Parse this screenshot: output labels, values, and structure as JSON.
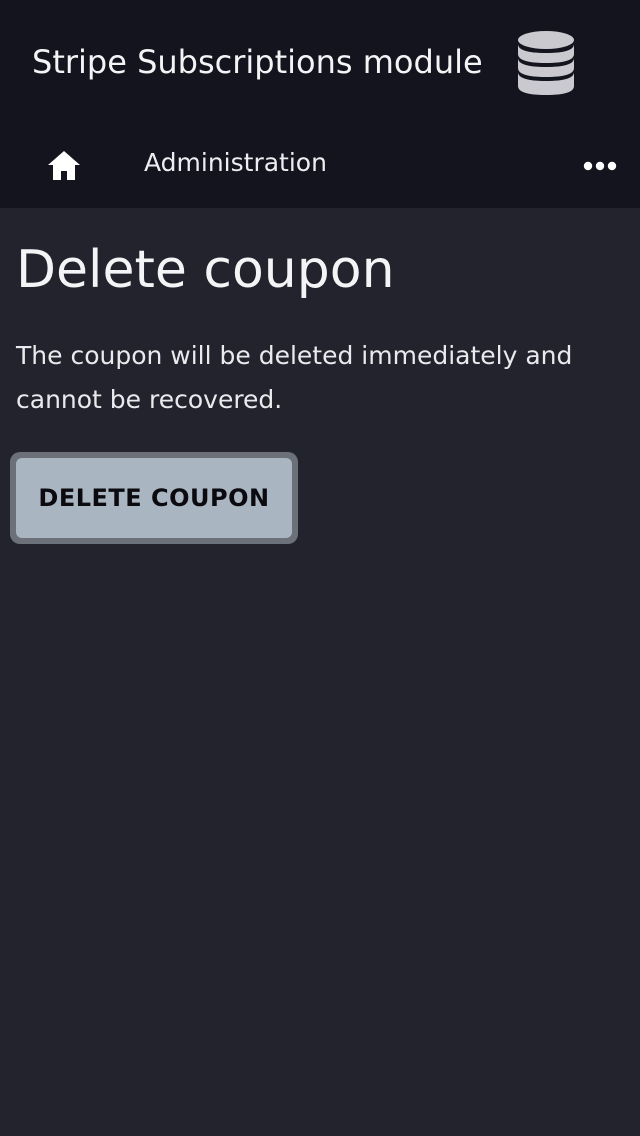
{
  "header": {
    "app_title": "Stripe Subscriptions module",
    "app_icon": "database-icon",
    "nav": {
      "home_icon": "home-icon",
      "admin_label": "Administration",
      "more_icon": "more-horizontal-icon"
    }
  },
  "main": {
    "title": "Delete coupon",
    "description": "The coupon will be deleted immediately and cannot be recovered.",
    "delete_button_label": "DELETE COUPON"
  },
  "colors": {
    "header_bg": "#13141d",
    "page_bg": "#22232c",
    "button_bg": "#a9b5c1",
    "button_border": "#6b7079"
  }
}
